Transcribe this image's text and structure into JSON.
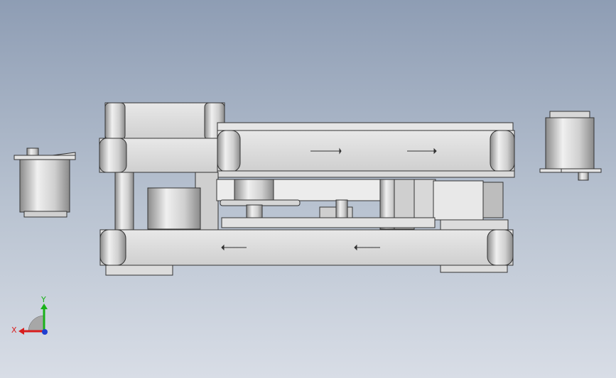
{
  "view": {
    "background_top": "#8e9db4",
    "background_bottom": "#d8dde6"
  },
  "model": {
    "belt_arrow_direction_upper": "right",
    "belt_arrow_direction_lower": "left",
    "part_color": "#dcdcdc",
    "edge_color": "#333333"
  },
  "triad": {
    "x_label": "X",
    "y_label": "Y",
    "x_color": "#d81e1e",
    "y_color": "#19b219",
    "z_color": "#1f3fd0"
  }
}
